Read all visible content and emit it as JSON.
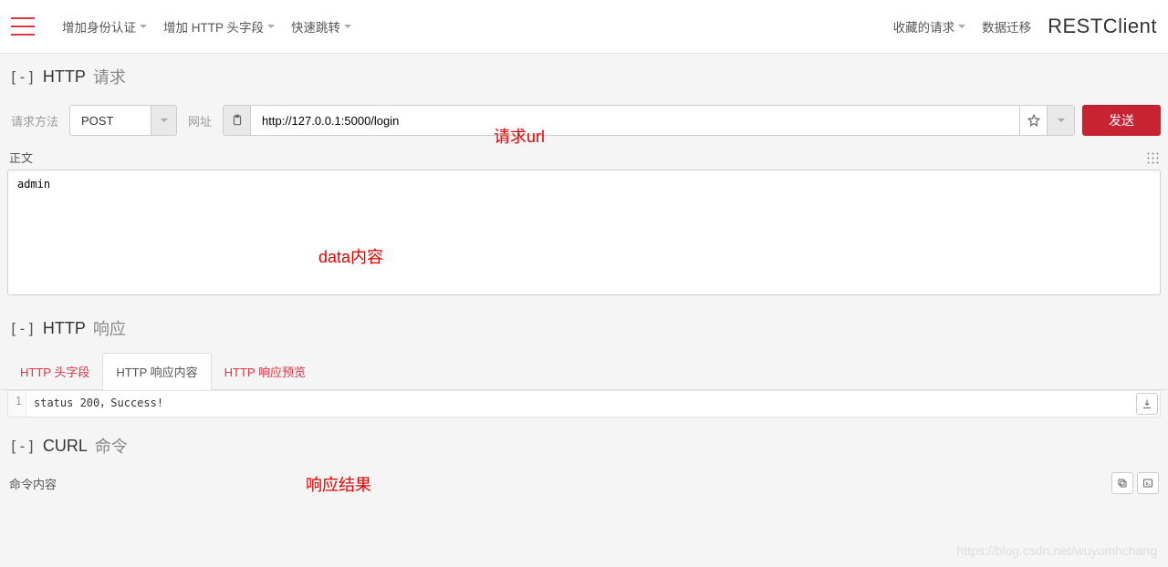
{
  "header": {
    "menu_auth": "增加身份认证",
    "menu_headers": "增加 HTTP 头字段",
    "menu_jump": "快速跳转",
    "menu_fav": "收藏的请求",
    "menu_migrate": "数据迁移",
    "brand": "RESTClient"
  },
  "request": {
    "toggle": "[-]",
    "title": "HTTP",
    "subtitle": "请求",
    "method_label": "请求方法",
    "method_value": "POST",
    "url_label": "网址",
    "url_value": "http://127.0.0.1:5000/login",
    "send_label": "发送",
    "body_label": "正文",
    "body_value": "admin"
  },
  "response": {
    "toggle": "[-]",
    "title": "HTTP",
    "subtitle": "响应",
    "tab_headers": "HTTP 头字段",
    "tab_content": "HTTP 响应内容",
    "tab_preview": "HTTP 响应预览",
    "line_no": "1",
    "body": "status 200，Success!"
  },
  "curl": {
    "toggle": "[-]",
    "title": "CURL",
    "subtitle": "命令",
    "content_label": "命令内容"
  },
  "annotations": {
    "url": "请求url",
    "body": "data内容",
    "result": "响应结果"
  },
  "watermark": "https://blog.csdn.net/wuyomhchang"
}
